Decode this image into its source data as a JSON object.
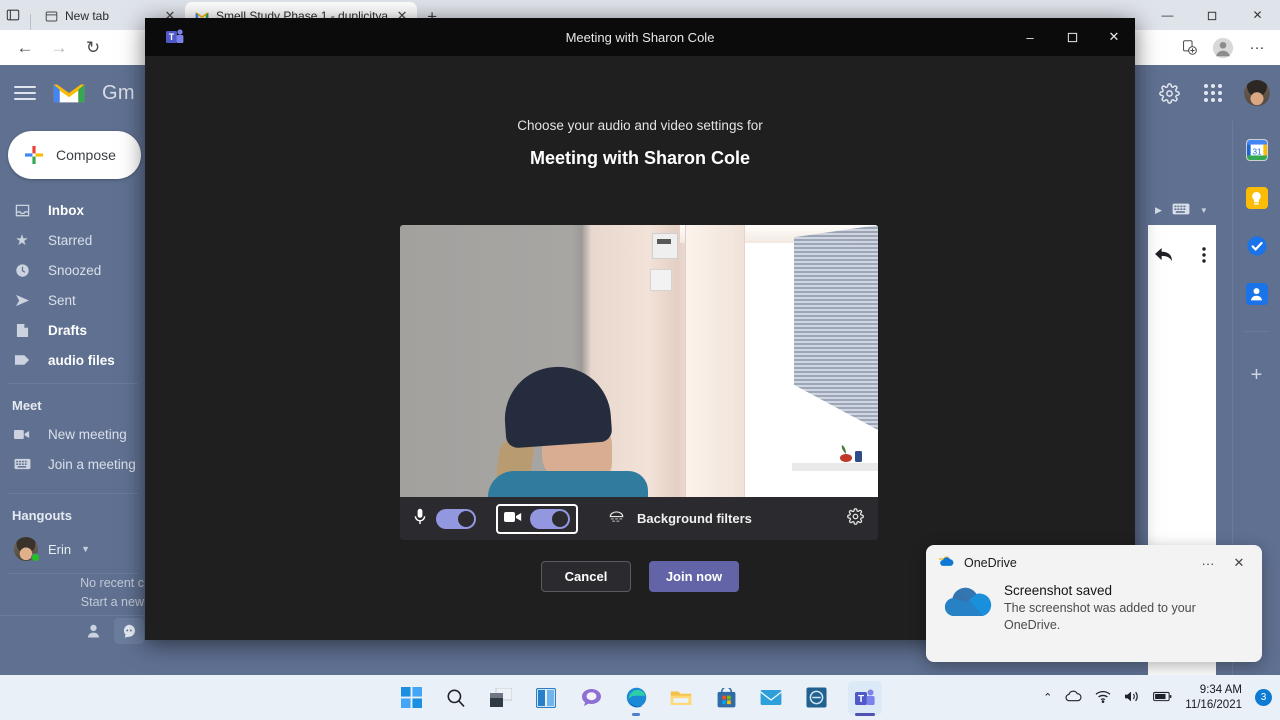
{
  "browser": {
    "tabs": [
      {
        "title": "New tab",
        "icon": "new-tab-icon",
        "active": false
      },
      {
        "title": "Smell Study Phase 1 - duplicitya",
        "icon": "gmail-favicon",
        "active": true
      }
    ],
    "new_tab_label": "+",
    "nav": {
      "back": "←",
      "forward": "→",
      "reload": "↻",
      "collections": "collections-icon",
      "profile": "profile-icon",
      "more": "···"
    },
    "window_controls": {
      "minimize": "—",
      "maximize": "❐",
      "close": "✕"
    }
  },
  "gmail": {
    "brand": "Gm",
    "menu_label": "menu-icon",
    "compose_label": "Compose",
    "nav_items": [
      {
        "label": "Inbox",
        "icon": "inbox-icon",
        "bold": true
      },
      {
        "label": "Starred",
        "icon": "star-icon",
        "bold": false
      },
      {
        "label": "Snoozed",
        "icon": "clock-icon",
        "bold": false
      },
      {
        "label": "Sent",
        "icon": "send-icon",
        "bold": false
      },
      {
        "label": "Drafts",
        "icon": "draft-icon",
        "bold": true
      },
      {
        "label": "audio files",
        "icon": "label-icon",
        "bold": true
      }
    ],
    "meet": {
      "title": "Meet",
      "items": [
        {
          "label": "New meeting",
          "icon": "video-camera-icon"
        },
        {
          "label": "Join a meeting",
          "icon": "keyboard-icon"
        }
      ]
    },
    "hangouts": {
      "title": "Hangouts",
      "user": "Erin",
      "status": "online",
      "empty_line1": "No recent c",
      "empty_line2": "Start a new"
    },
    "header_icons": [
      "gear-icon",
      "apps-grid-icon",
      "avatar"
    ],
    "right_rail": [
      "calendar-icon",
      "keep-icon",
      "tasks-icon",
      "contacts-icon",
      "add-icon"
    ],
    "reading_pane": {
      "reply": "reply-icon",
      "more": "more-vertical-icon"
    }
  },
  "teams": {
    "window_title": "Meeting with Sharon Cole",
    "logo": "teams-logo-icon",
    "window_controls": {
      "minimize": "—",
      "maximize": "❐",
      "close": "✕"
    },
    "subtitle": "Choose your audio and video settings for",
    "meeting_name": "Meeting with Sharon Cole",
    "controls": {
      "mic_icon": "microphone-icon",
      "mic_toggle": "on",
      "camera_icon": "camera-icon",
      "camera_toggle": "on",
      "background_filters_icon": "background-effects-icon",
      "background_filters_label": "Background filters",
      "device_settings_icon": "gear-icon"
    },
    "buttons": {
      "cancel": "Cancel",
      "join": "Join now"
    },
    "accent_color": "#6264a7",
    "toggle_color": "#9397e0"
  },
  "toast": {
    "app_name": "OneDrive",
    "app_icon": "onedrive-icon",
    "more": "···",
    "close": "✕",
    "title": "Screenshot saved",
    "body": "The screenshot was added to your OneDrive."
  },
  "taskbar": {
    "icons": [
      "start-icon",
      "search-icon",
      "task-view-icon",
      "widgets-icon",
      "chat-icon",
      "edge-icon",
      "file-explorer-icon",
      "store-icon",
      "mail-icon",
      "app-icon",
      "teams-icon"
    ],
    "tray": {
      "chevron": "⌃",
      "cloud": "onedrive-tray-icon",
      "wifi": "wifi-icon",
      "volume": "volume-icon",
      "battery": "battery-icon",
      "time": "9:34 AM",
      "date": "11/16/2021",
      "badge": "3"
    }
  }
}
